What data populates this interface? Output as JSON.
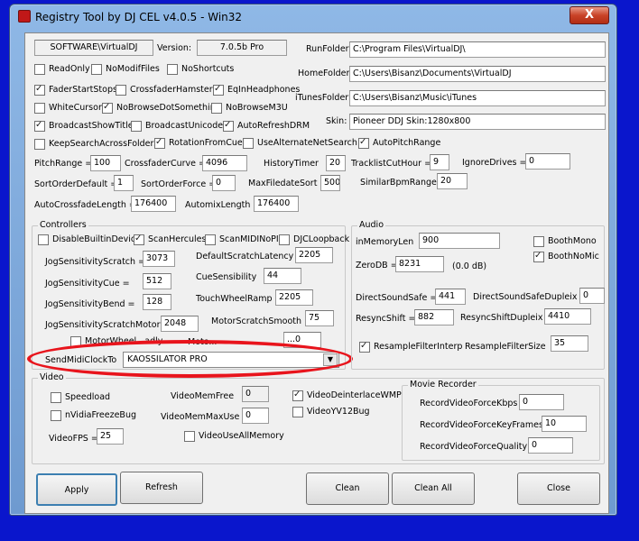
{
  "window": {
    "title": "Registry Tool by DJ CEL v4.0.5 - Win32",
    "close_label": "X"
  },
  "top": {
    "registry_path": "SOFTWARE\\VirtualDJ",
    "version_label": "Version:",
    "version_value": "7.0.5b Pro"
  },
  "paths": [
    {
      "label": "RunFolder:",
      "value": "C:\\Program Files\\VirtualDJ\\"
    },
    {
      "label": "HomeFolder:",
      "value": "C:\\Users\\Bisanz\\Documents\\VirtualDJ"
    },
    {
      "label": "iTunesFolder:",
      "value": "C:\\Users\\Bisanz\\Music\\iTunes"
    },
    {
      "label": "Skin:",
      "value": "Pioneer DDJ Skin:1280x800"
    }
  ],
  "checks": {
    "readonly": "ReadOnly",
    "nomodiffiles": "NoModifFiles",
    "noshortcuts": "NoShortcuts",
    "faderstartstops": "FaderStartStops",
    "crossfaderhamster": "CrossfaderHamster",
    "eqinheadphones": "EqInHeadphones",
    "whitecursor": "WhiteCursor",
    "nobrowsedot": "NoBrowseDotSomething",
    "nobrowsem3u": "NoBrowseM3U",
    "broadcastshowtitles": "BroadcastShowTitles",
    "broadcastunicode": "BroadcastUnicode",
    "autorefreshdrm": "AutoRefreshDRM",
    "keepsearch": "KeepSearchAcrossFolders",
    "rotationfromcue": "RotationFromCue",
    "usealternate": "UseAlternateNetSearch",
    "autopitchrange": "AutoPitchRange"
  },
  "fields": {
    "pitchrange": {
      "label": "PitchRange =",
      "value": "100"
    },
    "crossfadercurve": {
      "label": "CrossfaderCurve =",
      "value": "4096"
    },
    "historytimer": {
      "label": "HistoryTimer",
      "value": "20"
    },
    "tracklistcuthour": {
      "label": "TracklistCutHour =",
      "value": "9"
    },
    "ignoredrives": {
      "label": "IgnoreDrives =",
      "value": "0"
    },
    "sortorderdefault": {
      "label": "SortOrderDefault =",
      "value": "1"
    },
    "sortorderforce": {
      "label": "SortOrderForce =",
      "value": "0"
    },
    "maxfiledatesort": {
      "label": "MaxFiledateSort =",
      "value": "500"
    },
    "similarbpmrange": {
      "label": "SimilarBpmRange",
      "value": "20"
    },
    "autocrossfadelength": {
      "label": "AutoCrossfadeLength =",
      "value": "176400"
    },
    "automixlength": {
      "label": "AutomixLength =",
      "value": "176400"
    }
  },
  "controllers": {
    "title": "Controllers",
    "disablebuiltin": "DisableBuiltinDevice",
    "scanhercules": "ScanHercules",
    "scanmidinopid": "ScanMIDINoPID",
    "djcloopback": "DJCLoopback",
    "jogscratch": {
      "label": "JogSensitivityScratch =",
      "value": "3073"
    },
    "defaultscratchlatency": {
      "label": "DefaultScratchLatency =",
      "value": "2205"
    },
    "jogcue": {
      "label": "JogSensitivityCue =",
      "value": "512"
    },
    "cuesensibility": {
      "label": "CueSensibility",
      "value": "44"
    },
    "jogbend": {
      "label": "JogSensitivityBend =",
      "value": "128"
    },
    "touchwheelramp": {
      "label": "TouchWheelRamp",
      "value": "2205"
    },
    "jogscratchmotor": {
      "label": "JogSensitivityScratchMotor =",
      "value": "2048"
    },
    "motorscratchsmooth": {
      "label": "MotorScratchSmooth",
      "value": "75"
    },
    "motorwheelpartial": "MotorWheel...adly",
    "motorpartial": "Moto...",
    "motorpartial_value": "...0",
    "sendmidiclockto": {
      "label": "SendMidiClockTo",
      "value": "KAOSSILATOR PRO"
    }
  },
  "audio": {
    "title": "Audio",
    "inmemorylen": {
      "label": "inMemoryLen",
      "value": "900"
    },
    "boothmono": "BoothMono",
    "boothnomic": "BoothNoMic",
    "zerodb": {
      "label": "ZeroDB =",
      "value": "8231",
      "note": "(0.0 dB)"
    },
    "directsoundsafe": {
      "label": "DirectSoundSafe =",
      "value": "441"
    },
    "directsoundsafeduplex": {
      "label": "DirectSoundSafeDupleix =",
      "value": "0"
    },
    "resyncshift": {
      "label": "ResyncShift =",
      "value": "882"
    },
    "resyncshiftduplex": {
      "label": "ResyncShiftDupleix =",
      "value": "4410"
    },
    "resamplefilterinterp": "ResampleFilterInterp",
    "resamplefiltersize": {
      "label": "ResampleFilterSize",
      "value": "35"
    }
  },
  "video": {
    "title": "Video",
    "speedload": "Speedload",
    "nvidiafreezebug": "nVidiaFreezeBug",
    "videofps": {
      "label": "VideoFPS =",
      "value": "25"
    },
    "videomemfree": {
      "label": "VideoMemFree",
      "value": "0"
    },
    "videomemmaxuse": {
      "label": "VideoMemMaxUse",
      "value": "0"
    },
    "videouseallmemory": "VideoUseAllMemory",
    "videodeinterlacewmp": "VideoDeinterlaceWMP",
    "videoyv12bug": "VideoYV12Bug"
  },
  "movie": {
    "title": "Movie Recorder",
    "kbps": {
      "label": "RecordVideoForceKbps =",
      "value": "0"
    },
    "keyframes": {
      "label": "RecordVideoForceKeyFrames",
      "value": "10"
    },
    "quality": {
      "label": "RecordVideoForceQuality =",
      "value": "0"
    }
  },
  "buttons": {
    "apply": "Apply",
    "refresh": "Refresh",
    "clean": "Clean",
    "cleanall": "Clean All",
    "close": "Close"
  },
  "colors": {
    "desktop": "#0a16cc",
    "highlight_ellipse": "#e8141c"
  }
}
